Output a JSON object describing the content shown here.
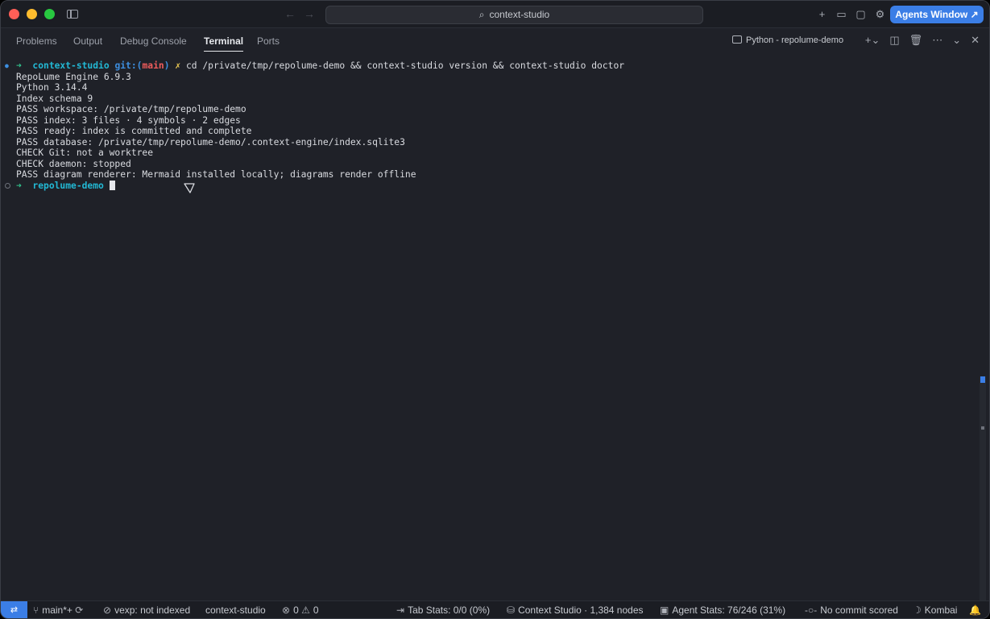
{
  "titlebar": {
    "search_text": "context-studio",
    "agents_button": "Agents Window ↗"
  },
  "panel": {
    "tabs": [
      "Problems",
      "Output",
      "Debug Console",
      "Terminal",
      "Ports"
    ],
    "active_tab": "Terminal",
    "terminal_name": "Python - repolume-demo"
  },
  "terminal": {
    "prompt_dir": "context-studio",
    "prompt_git": "git:(",
    "prompt_branch": "main",
    "prompt_git_close": ")",
    "prompt_dirty": "✗",
    "command": "cd /private/tmp/repolume-demo && context-studio version && context-studio doctor",
    "output": [
      "RepoLume Engine 6.9.3",
      "Python 3.14.4",
      "Index schema 9",
      "PASS workspace: /private/tmp/repolume-demo",
      "PASS index: 3 files · 4 symbols · 2 edges",
      "PASS ready: index is committed and complete",
      "PASS database: /private/tmp/repolume-demo/.context-engine/index.sqlite3",
      "CHECK Git: not a worktree",
      "CHECK daemon: stopped",
      "PASS diagram renderer: Mermaid installed locally; diagrams render offline"
    ],
    "second_prompt_dir": "repolume-demo"
  },
  "statusbar": {
    "branch": "main*+",
    "vexp": "vexp: not indexed",
    "workspace": "context-studio",
    "errors": "0",
    "warnings": "0",
    "tab_stats": "Tab Stats: 0/0 (0%)",
    "context_studio": "Context Studio · 1,384 nodes",
    "agent_stats": "Agent Stats: 76/246 (31%)",
    "commit": "No commit scored",
    "theme": "Kombai"
  }
}
